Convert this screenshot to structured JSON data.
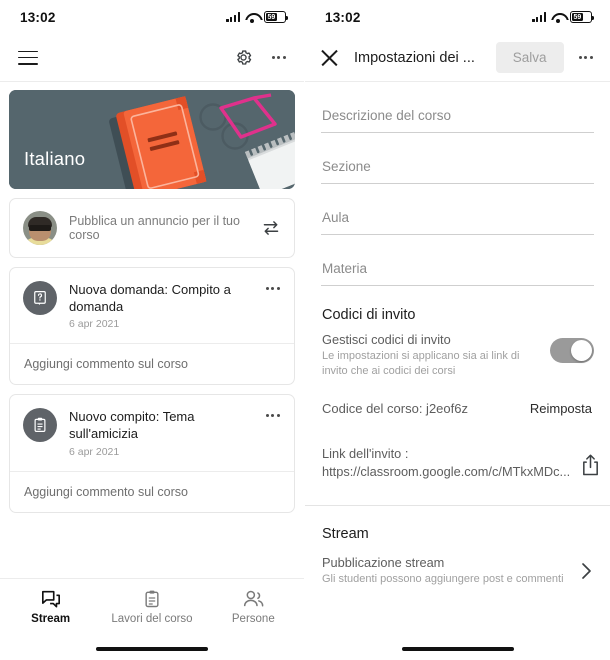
{
  "status_bar": {
    "time": "13:02",
    "battery_level": "59",
    "signal_icon": "cellular-signal-icon",
    "wifi_icon": "wifi-icon",
    "battery_icon": "battery-icon"
  },
  "left_screen": {
    "app_bar": {
      "menu_icon": "hamburger-menu-icon",
      "settings_icon": "gear-icon",
      "overflow_icon": "more-options-icon"
    },
    "banner": {
      "course_name": "Italiano",
      "background_color": "#55666d",
      "book_color": "#f4663a",
      "glasses_color": "#e0318c"
    },
    "announcement": {
      "placeholder": "Pubblica un annuncio per il tuo corso",
      "avatar": "user-avatar",
      "swap_icon": "swap-arrows-icon"
    },
    "posts": [
      {
        "icon": "question-assignment-icon",
        "title": "Nuova domanda: Compito a domanda",
        "date": "6 apr 2021",
        "comment_placeholder": "Aggiungi commento sul corso"
      },
      {
        "icon": "assignment-clipboard-icon",
        "title": "Nuovo compito: Tema sull'amicizia",
        "date": "6 apr 2021",
        "comment_placeholder": "Aggiungi commento sul corso"
      }
    ],
    "bottom_nav": [
      {
        "label": "Stream",
        "icon": "stream-chat-icon",
        "active": true
      },
      {
        "label": "Lavori del corso",
        "icon": "classwork-clipboard-icon",
        "active": false
      },
      {
        "label": "Persone",
        "icon": "people-icon",
        "active": false
      }
    ]
  },
  "right_screen": {
    "app_bar": {
      "close_icon": "close-icon",
      "title": "Impostazioni dei ...",
      "save_label": "Salva",
      "overflow_icon": "more-options-icon"
    },
    "fields": [
      {
        "placeholder": "Descrizione del corso",
        "value": ""
      },
      {
        "placeholder": "Sezione",
        "value": ""
      },
      {
        "placeholder": "Aula",
        "value": ""
      },
      {
        "placeholder": "Materia",
        "value": ""
      }
    ],
    "invite_section": {
      "title": "Codici di invito",
      "manage_label": "Gestisci codici di invito",
      "manage_sub": "Le impostazioni si applicano sia ai link di invito che ai codici dei corsi",
      "toggle_on": true,
      "toggle_color": "#9a9a9a",
      "course_code_label": "Codice del corso: j2eof6z",
      "reset_label": "Reimposta",
      "link_label": "Link dell'invito :",
      "link_url": "https://classroom.google.com/c/MTkxMDc...",
      "share_icon": "share-icon"
    },
    "stream_section": {
      "title": "Stream",
      "row_label": "Pubblicazione stream",
      "row_sub": "Gli studenti possono aggiungere post e commenti",
      "chevron_icon": "chevron-right-icon"
    }
  }
}
